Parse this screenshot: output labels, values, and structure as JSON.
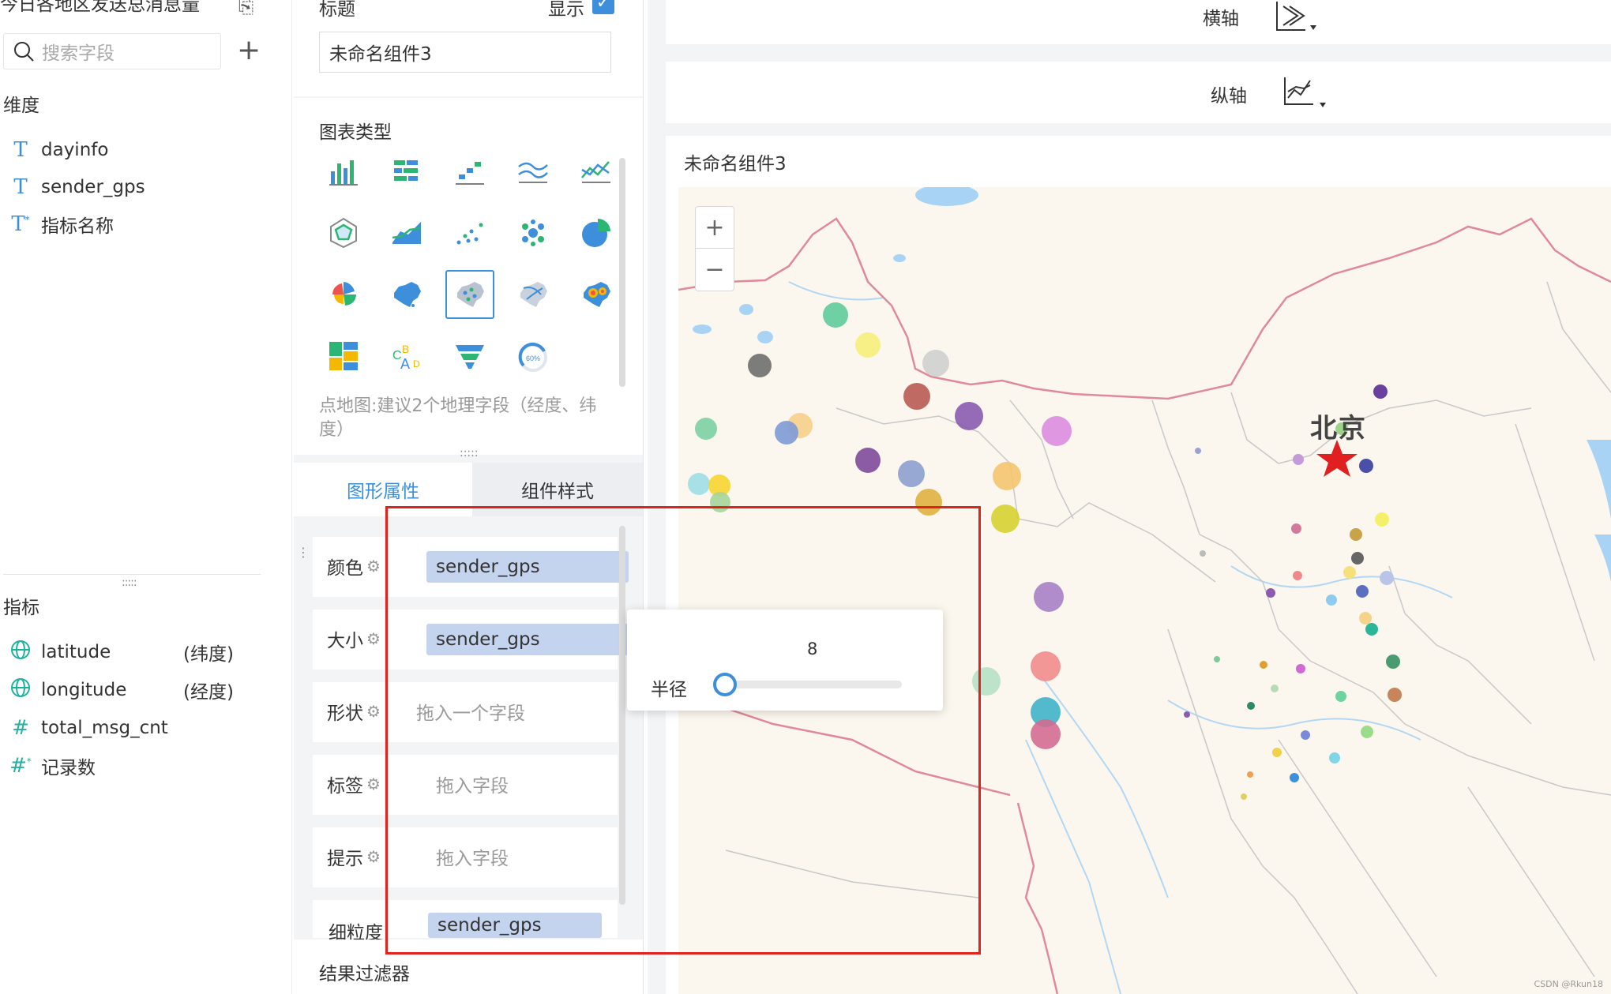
{
  "left_panel": {
    "title": "今日各地区发送总消息量",
    "search_placeholder": "搜索字段",
    "add_label": "+",
    "dimensions_title": "维度",
    "dimensions": [
      {
        "icon": "text-type-icon",
        "glyph": "T",
        "name": "dayinfo"
      },
      {
        "icon": "text-type-icon",
        "glyph": "T",
        "name": "sender_gps"
      },
      {
        "icon": "text-calc-type-icon",
        "glyph": "T",
        "name": "指标名称"
      }
    ],
    "measures_title": "指标",
    "measures": [
      {
        "icon": "globe-icon",
        "name": "latitude",
        "tag": "(纬度)"
      },
      {
        "icon": "globe-icon",
        "name": "longitude",
        "tag": "(经度)"
      },
      {
        "icon": "hash-icon",
        "name": "total_msg_cnt",
        "tag": ""
      },
      {
        "icon": "hash-calc-icon",
        "name": "记录数",
        "tag": ""
      }
    ]
  },
  "config_panel": {
    "title_label": "标题",
    "show_label": "显示",
    "title_value": "未命名组件3",
    "chart_type_title": "图表类型",
    "chart_hint": "点地图:建议2个地理字段（经度、纬度）",
    "tabs": [
      "图形属性",
      "组件样式"
    ],
    "active_tab": "图形属性",
    "props": {
      "color_label": "颜色",
      "color_value": "sender_gps",
      "size_label": "大小",
      "size_value": "sender_gps",
      "shape_label": "形状",
      "shape_placeholder": "拖入一个字段",
      "tag_label": "标签",
      "tag_placeholder": "拖入字段",
      "tip_label": "提示",
      "tip_placeholder": "拖入字段",
      "granularity_label": "细粒度",
      "granularity_value": "sender_gps"
    },
    "result_filter": "结果过滤器",
    "gauge_label": "60%"
  },
  "axes": {
    "x_label": "横轴",
    "y_label": "纵轴"
  },
  "map_card": {
    "title": "未命名组件3",
    "city_label": "北京",
    "zoom_in": "+",
    "zoom_out": "−",
    "watermark": "CSDN @Rkun18"
  },
  "radius_popover": {
    "value": "8",
    "label": "半径",
    "slider_fraction": 0.05
  },
  "colors": {
    "accent": "#3d8fdc",
    "highlight_border": "#e0231c",
    "pill_bg": "#c4d3ee"
  }
}
